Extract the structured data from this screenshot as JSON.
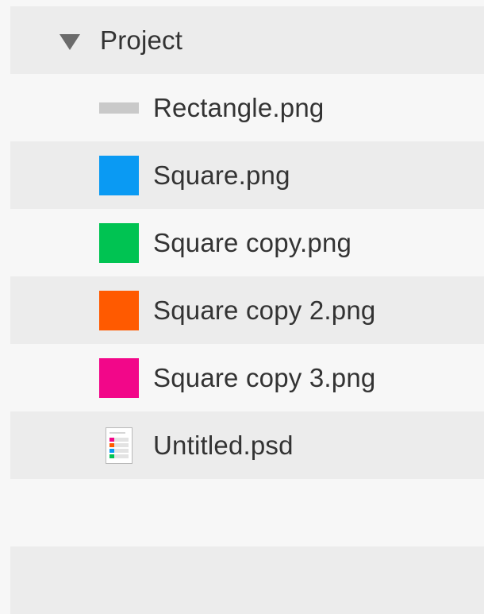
{
  "tree": {
    "project": {
      "label": "Project",
      "expanded": true,
      "icon": "disclosure-triangle-down-icon"
    },
    "files": [
      {
        "name": "Rectangle.png",
        "thumbnail": "rectangle-thumbnail",
        "color": "#c9c9c9"
      },
      {
        "name": "Square.png",
        "thumbnail": "square-thumbnail",
        "color": "#0a9af3"
      },
      {
        "name": "Square copy.png",
        "thumbnail": "square-thumbnail",
        "color": "#00c352"
      },
      {
        "name": "Square copy 2.png",
        "thumbnail": "square-thumbnail",
        "color": "#ff5a00"
      },
      {
        "name": "Square copy 3.png",
        "thumbnail": "square-thumbnail",
        "color": "#f20789"
      },
      {
        "name": "Untitled.psd",
        "thumbnail": "psd-document-icon",
        "layer_colors": [
          "#f20789",
          "#ff5a00",
          "#0a9af3",
          "#00c352"
        ]
      }
    ]
  },
  "colors": {
    "row_alt": "#ececec",
    "row_plain": "#f7f7f7",
    "text": "#333333",
    "disclosure": "#6b6b6b"
  }
}
